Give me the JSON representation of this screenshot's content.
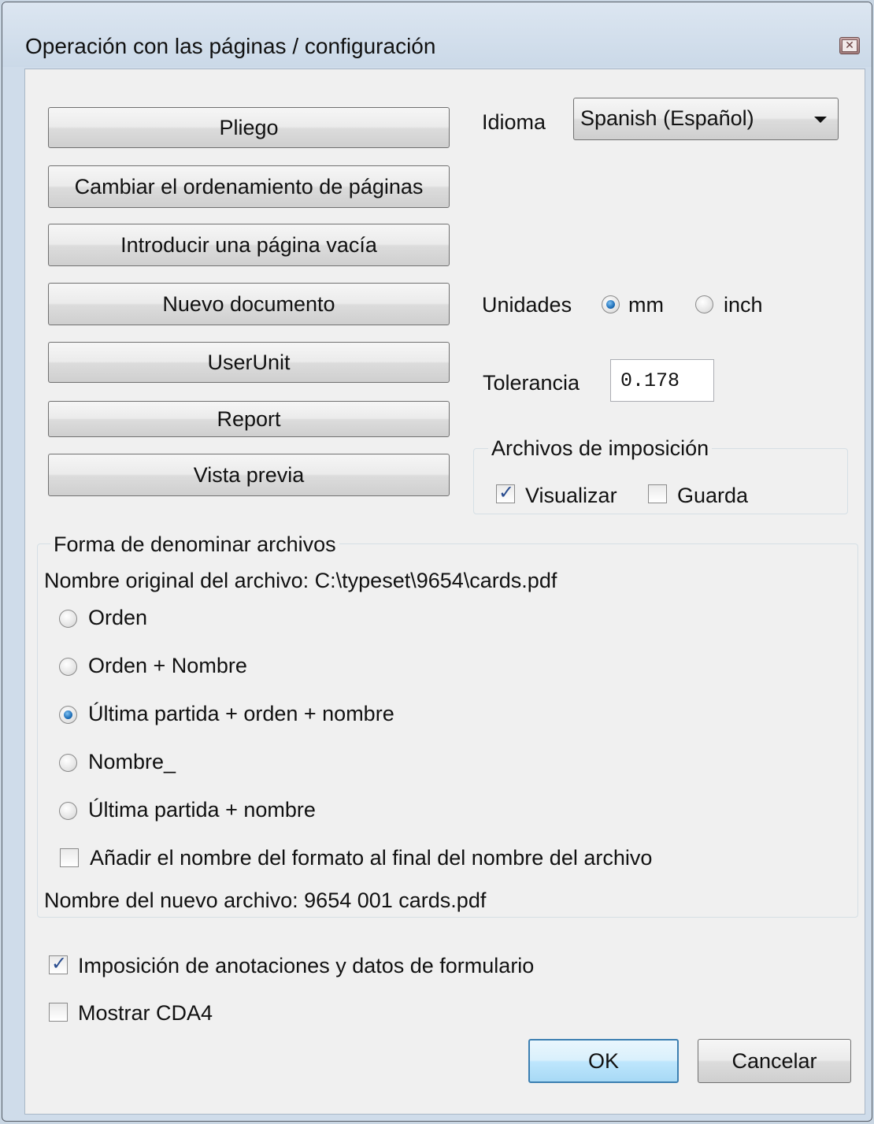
{
  "window": {
    "title": "Operación con las páginas / configuración",
    "close_icon": "close-icon"
  },
  "left_buttons": {
    "pliego": "Pliego",
    "cambiar": "Cambiar el ordenamiento de páginas",
    "introducir": "Introducir una página vacía",
    "nuevo": "Nuevo documento",
    "userunit": "UserUnit",
    "report": "Report",
    "vista": "Vista previa"
  },
  "idioma": {
    "label": "Idioma",
    "selected": "Spanish (Español)"
  },
  "unidades": {
    "label": "Unidades",
    "options": [
      "mm",
      "inch"
    ],
    "selected": "mm"
  },
  "tolerancia": {
    "label": "Tolerancia",
    "value": "0.178"
  },
  "imposicion_files": {
    "legend": "Archivos de imposición",
    "visualizar": {
      "label": "Visualizar",
      "checked": true
    },
    "guarda": {
      "label": "Guarda",
      "checked": false
    }
  },
  "naming": {
    "legend": "Forma de denominar archivos",
    "original": "Nombre original del archivo: C:\\typeset\\9654\\cards.pdf",
    "options": [
      "Orden",
      "Orden + Nombre",
      "Última partida + orden + nombre",
      "Nombre_",
      "Última partida + nombre"
    ],
    "selected_index": 2,
    "append_format": {
      "label": "Añadir el nombre del formato al final del nombre del archivo",
      "checked": false
    },
    "new_name": "Nombre del nuevo archivo: 9654 001 cards.pdf"
  },
  "bottom_checks": {
    "imposicion_anotaciones": {
      "label": "Imposición de anotaciones y datos de formulario",
      "checked": true
    },
    "mostrar_cda4": {
      "label": "Mostrar CDA4",
      "checked": false
    }
  },
  "footer": {
    "ok": "OK",
    "cancel": "Cancelar"
  }
}
